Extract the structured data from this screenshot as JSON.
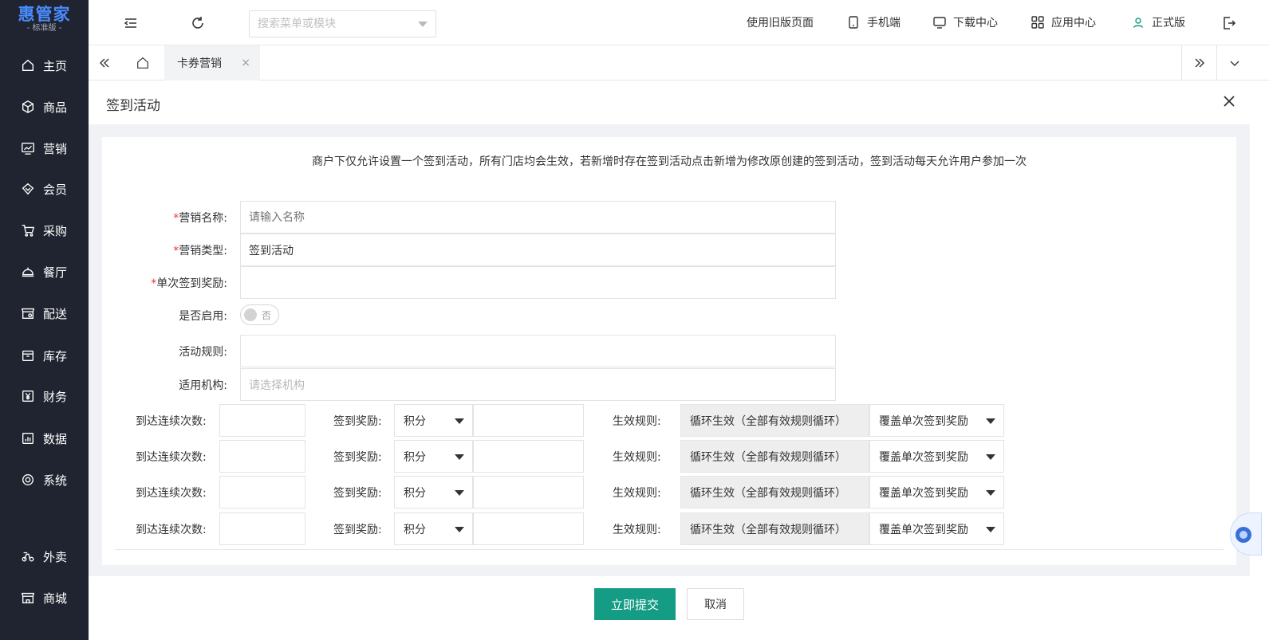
{
  "brand": {
    "name": "惠管家",
    "edition": "- 标准版 -"
  },
  "sidebar": {
    "items": [
      {
        "label": "主页",
        "icon": "home-icon"
      },
      {
        "label": "商品",
        "icon": "box-icon"
      },
      {
        "label": "营销",
        "icon": "chart-icon"
      },
      {
        "label": "会员",
        "icon": "diamond-icon"
      },
      {
        "label": "采购",
        "icon": "cart-icon"
      },
      {
        "label": "餐厅",
        "icon": "cloche-icon"
      },
      {
        "label": "配送",
        "icon": "store-icon"
      },
      {
        "label": "库存",
        "icon": "archive-icon"
      },
      {
        "label": "财务",
        "icon": "yen-icon"
      },
      {
        "label": "数据",
        "icon": "bar-chart-icon"
      },
      {
        "label": "系统",
        "icon": "settings-icon"
      },
      {
        "label": "外卖",
        "icon": "scooter-icon"
      },
      {
        "label": "商城",
        "icon": "shop-icon"
      }
    ]
  },
  "header": {
    "search_placeholder": "搜索菜单或模块",
    "links": {
      "old_page": "使用旧版页面",
      "mobile": "手机端",
      "download": "下载中心",
      "apps": "应用中心",
      "version": "正式版"
    }
  },
  "tabs": {
    "active": "卡券营销",
    "close": "×"
  },
  "page": {
    "title": "签到活动"
  },
  "form": {
    "notice": "商户下仅允许设置一个签到活动，所有门店均会生效，若新增时存在签到活动点击新增为修改原创建的签到活动，签到活动每天允许用户参加一次",
    "required_mark": "*",
    "name_label": "营销名称:",
    "name_placeholder": "请输入名称",
    "type_label": "营销类型:",
    "type_value": "签到活动",
    "reward_label": "单次签到奖励:",
    "enable_label": "是否启用:",
    "enable_toggle": "否",
    "rules_label": "活动规则:",
    "org_label": "适用机构:",
    "org_placeholder": "请选择机构",
    "reward_rows": [
      {
        "count_label": "到达连续次数:",
        "reward_label": "签到奖励:",
        "reward_type": "积分",
        "rule_label": "生效规则:",
        "rule_value": "循环生效（全部有效规则循环）",
        "cover_option": "覆盖单次签到奖励"
      },
      {
        "count_label": "到达连续次数:",
        "reward_label": "签到奖励:",
        "reward_type": "积分",
        "rule_label": "生效规则:",
        "rule_value": "循环生效（全部有效规则循环）",
        "cover_option": "覆盖单次签到奖励"
      },
      {
        "count_label": "到达连续次数:",
        "reward_label": "签到奖励:",
        "reward_type": "积分",
        "rule_label": "生效规则:",
        "rule_value": "循环生效（全部有效规则循环）",
        "cover_option": "覆盖单次签到奖励"
      },
      {
        "count_label": "到达连续次数:",
        "reward_label": "签到奖励:",
        "reward_type": "积分",
        "rule_label": "生效规则:",
        "rule_value": "循环生效（全部有效规则循环）",
        "cover_option": "覆盖单次签到奖励"
      }
    ]
  },
  "footer": {
    "submit": "立即提交",
    "cancel": "取消"
  },
  "colors": {
    "sidebar_bg": "#1f2430",
    "primary": "#149c84",
    "brand": "#4a8cff",
    "required": "#e4393c"
  }
}
